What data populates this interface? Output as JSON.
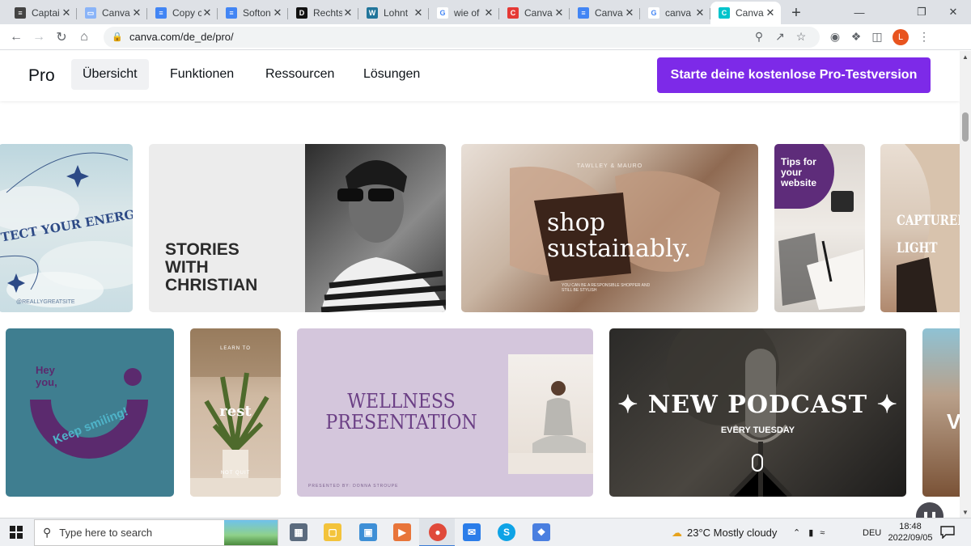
{
  "browser": {
    "tabs": [
      {
        "title": "Captai",
        "favicon_color": "#444444",
        "favicon_glyph": "≡"
      },
      {
        "title": "Canva",
        "favicon_color": "#8ab4f8",
        "favicon_glyph": "▭"
      },
      {
        "title": "Copy c",
        "favicon_color": "#4285f4",
        "favicon_glyph": "≡"
      },
      {
        "title": "Softon",
        "favicon_color": "#4285f4",
        "favicon_glyph": "≡"
      },
      {
        "title": "Rechts",
        "favicon_color": "#111111",
        "favicon_glyph": "D"
      },
      {
        "title": "Lohnt",
        "favicon_color": "#21759b",
        "favicon_glyph": "W"
      },
      {
        "title": "wie of",
        "favicon_color": "#ffffff",
        "favicon_glyph": "G"
      },
      {
        "title": "Canva",
        "favicon_color": "#e53935",
        "favicon_glyph": "C"
      },
      {
        "title": "Canva",
        "favicon_color": "#4285f4",
        "favicon_glyph": "≡"
      },
      {
        "title": "canva",
        "favicon_color": "#ffffff",
        "favicon_glyph": "G"
      },
      {
        "title": "Canva",
        "favicon_color": "#00c4cc",
        "favicon_glyph": "C",
        "active": true
      }
    ],
    "new_tab_glyph": "+",
    "url": "canva.com/de_de/pro/",
    "profile_initial": "L"
  },
  "page": {
    "brand": "Pro",
    "nav": [
      "Übersicht",
      "Funktionen",
      "Ressourcen",
      "Lösungen"
    ],
    "active_nav": "Übersicht",
    "cta_label": "Starte deine kostenlose Pro-Testversion",
    "accent_color": "#7d2ae8",
    "templates_row1": [
      {
        "name": "protect-your-energy",
        "text": "TECT YOUR ENERGY",
        "subtext": "@REALLYGREATSITE"
      },
      {
        "name": "stories-with-christian",
        "text": "STORIES\nWITH\nCHRISTIAN"
      },
      {
        "name": "shop-sustainably",
        "brand": "TAWLLEY & MAURO",
        "text": "shop\nsustainably.",
        "subtext": "YOU CAN BE A RESPONSIBLE SHOPPER AND STILL BE STYLISH"
      },
      {
        "name": "tips-for-website",
        "text": "Tips for\nyour\nwebsite"
      },
      {
        "name": "captured-light",
        "text": "CAPTURED\nLIGHT"
      }
    ],
    "templates_row2": [
      {
        "name": "keep-smiling",
        "text": "Hey\nyou,",
        "subtext": "Keep smiling!"
      },
      {
        "name": "rest",
        "text": "rest",
        "top": "LEARN TO",
        "bottom": "NOT QUIT"
      },
      {
        "name": "wellness-presentation",
        "text": "WELLNESS\nPRESENTATION",
        "subtext": "PRESENTED BY: DONNA STROUPE"
      },
      {
        "name": "new-podcast",
        "text": "NEW PODCAST",
        "subtext": "EVERY TUESDAY"
      }
    ]
  },
  "taskbar": {
    "search_placeholder": "Type here to search",
    "weather": "23°C  Mostly cloudy",
    "language": "DEU",
    "time": "18:48",
    "date": "2022/09/05"
  }
}
